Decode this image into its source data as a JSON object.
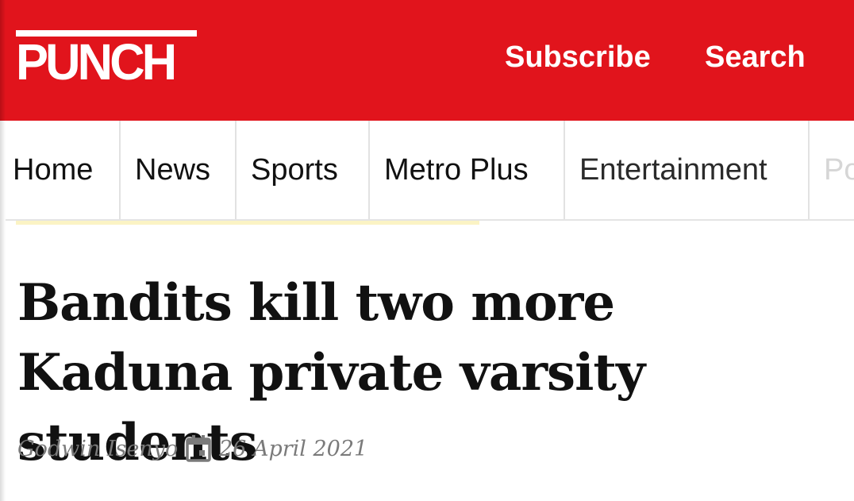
{
  "header": {
    "logo_text": "PUNCH",
    "subscribe_label": "Subscribe",
    "search_label": "Search",
    "background_color": "#e1141c"
  },
  "nav": {
    "items": [
      {
        "label": "Home"
      },
      {
        "label": "News"
      },
      {
        "label": "Sports"
      },
      {
        "label": "Metro Plus"
      },
      {
        "label": "Entertainment"
      },
      {
        "label": "Po"
      }
    ]
  },
  "article": {
    "headline": "Bandits kill two more Kaduna private varsity students",
    "author": "Godwin Isenyo",
    "date": "26 April 2021",
    "date_icon": "calendar-icon"
  }
}
